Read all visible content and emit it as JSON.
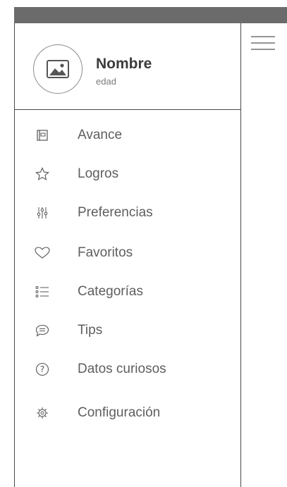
{
  "profile": {
    "name": "Nombre",
    "age": "edad",
    "avatar_icon": "image-placeholder-icon"
  },
  "menu": {
    "items": [
      {
        "label": "Avance",
        "icon": "notebook-icon"
      },
      {
        "label": "Logros",
        "icon": "star-icon"
      },
      {
        "label": "Preferencias",
        "icon": "sliders-icon"
      },
      {
        "label": "Favoritos",
        "icon": "heart-icon"
      },
      {
        "label": "Categorías",
        "icon": "list-icon"
      },
      {
        "label": "Tips",
        "icon": "chat-bubble-icon"
      },
      {
        "label": "Datos curiosos",
        "icon": "question-circle-icon"
      },
      {
        "label": "Configuración",
        "icon": "gear-icon"
      }
    ]
  },
  "header": {
    "menu_icon": "hamburger-menu-icon"
  },
  "colors": {
    "status_bar": "#6b6b6b",
    "border": "#4a4a4a",
    "text": "#5e5e5e"
  }
}
